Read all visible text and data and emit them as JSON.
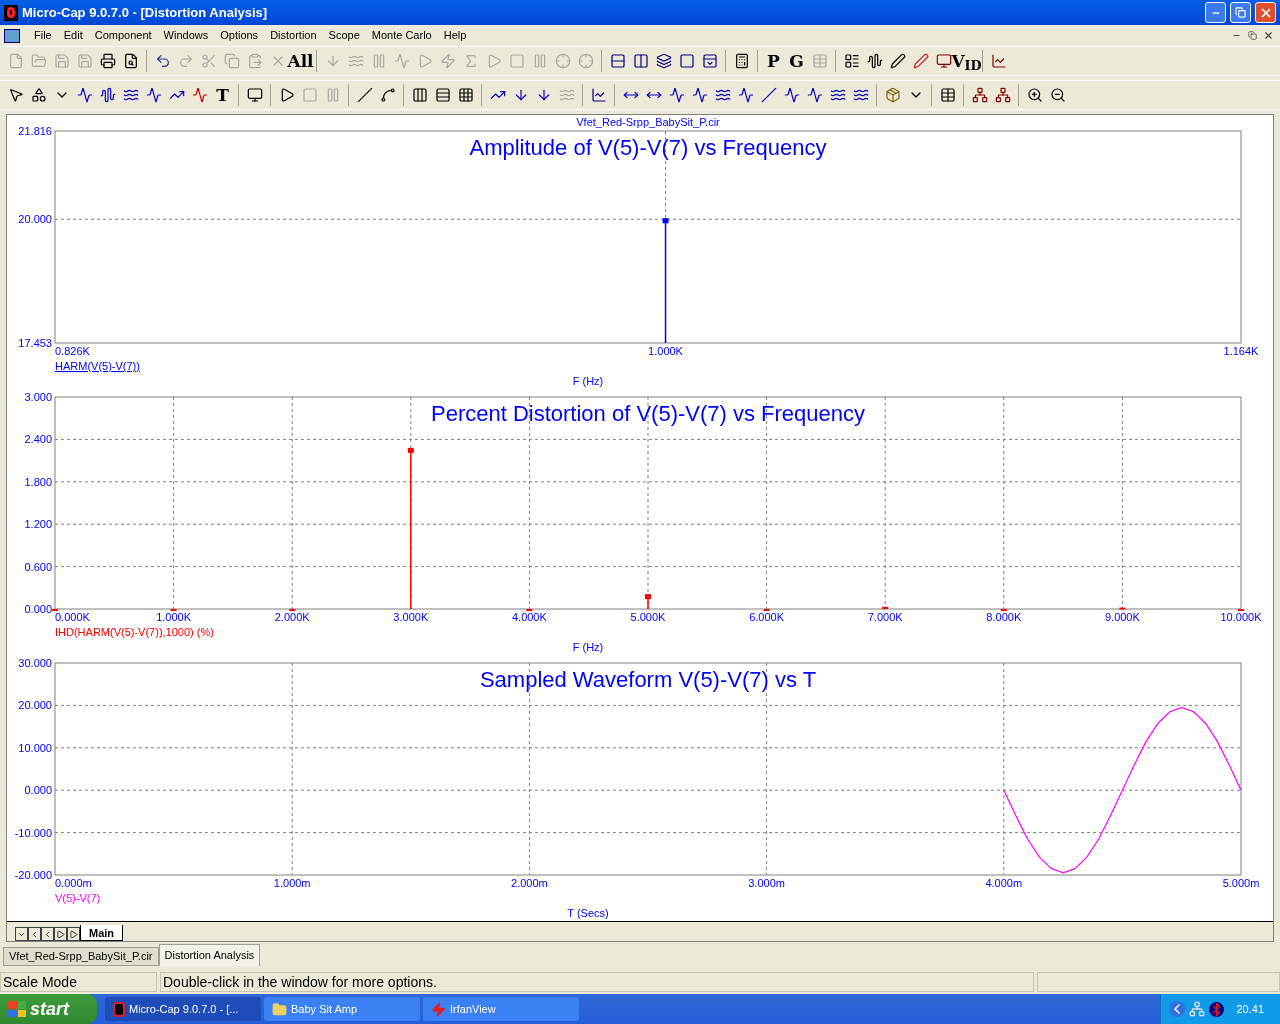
{
  "window": {
    "title": "Micro-Cap 9.0.7.0 - [Distortion Analysis]"
  },
  "menu": [
    "File",
    "Edit",
    "Component",
    "Windows",
    "Options",
    "Distortion",
    "Scope",
    "Monte Carlo",
    "Help"
  ],
  "toolbar_labels": [
    "All",
    "P",
    "G",
    "T",
    "V$_{I}$$_{D}$"
  ],
  "plots": [
    {
      "header": "Vfet_Red-Srpp_BabySit_P.cir",
      "chart_data": {
        "type": "bar",
        "title": "Amplitude of V(5)-V(7) vs Frequency",
        "xlabel": "F (Hz)",
        "x": [
          1.0
        ],
        "series": [
          {
            "name": "HARM(V(5)-V(7))",
            "color": "#0000ff",
            "values": [
              20.02
            ]
          }
        ],
        "grid": true,
        "xlim": [
          0.826,
          1.164
        ],
        "ylim": [
          17.453,
          21.816
        ],
        "xticks": [
          {
            "value": 0.826,
            "label": "0.826K"
          },
          {
            "value": 1.0,
            "label": "1.000K"
          },
          {
            "value": 1.164,
            "label": "1.164K"
          }
        ],
        "yticks": [
          {
            "value": 17.453,
            "label": "17.453"
          },
          {
            "value": 20,
            "label": "20.000"
          },
          {
            "value": 21.816,
            "label": "21.816"
          }
        ]
      }
    },
    {
      "chart_data": {
        "type": "bar",
        "title": "Percent Distortion of V(5)-V(7) vs Frequency",
        "xlabel": "F (Hz)",
        "x": [
          0,
          1,
          2,
          3,
          4,
          5,
          6,
          7,
          8,
          9,
          10
        ],
        "series": [
          {
            "name": "IHD(HARM(V(5)-V(7)),1000) (%)",
            "color": "#ff0000",
            "values": [
              0,
              0,
              0,
              2.28,
              0,
              0.21,
              0,
              0.03,
              0,
              0.02,
              0
            ]
          }
        ],
        "grid": true,
        "xlim": [
          0,
          10
        ],
        "ylim": [
          0,
          3
        ],
        "xticks": [
          {
            "value": 0,
            "label": "0.000K"
          },
          {
            "value": 1,
            "label": "1.000K"
          },
          {
            "value": 2,
            "label": "2.000K"
          },
          {
            "value": 3,
            "label": "3.000K"
          },
          {
            "value": 4,
            "label": "4.000K"
          },
          {
            "value": 5,
            "label": "5.000K"
          },
          {
            "value": 6,
            "label": "6.000K"
          },
          {
            "value": 7,
            "label": "7.000K"
          },
          {
            "value": 8,
            "label": "8.000K"
          },
          {
            "value": 9,
            "label": "9.000K"
          },
          {
            "value": 10,
            "label": "10.000K"
          }
        ],
        "yticks": [
          {
            "value": 0,
            "label": "0.000"
          },
          {
            "value": 0.6,
            "label": "0.600"
          },
          {
            "value": 1.2,
            "label": "1.200"
          },
          {
            "value": 1.8,
            "label": "1.800"
          },
          {
            "value": 2.4,
            "label": "2.400"
          },
          {
            "value": 3,
            "label": "3.000"
          }
        ]
      }
    },
    {
      "chart_data": {
        "type": "line",
        "title": "Sampled Waveform  V(5)-V(7) vs T",
        "xlabel": "T (Secs)",
        "x": [
          4.0,
          4.05,
          4.1,
          4.15,
          4.2,
          4.25,
          4.3,
          4.35,
          4.4,
          4.45,
          4.5,
          4.55,
          4.6,
          4.65,
          4.7,
          4.75,
          4.8,
          4.85,
          4.9,
          4.95,
          5.0
        ],
        "series": [
          {
            "name": "V(5)-V(7)",
            "color": "#ff00ff",
            "values": [
              0,
              -6.0,
              -11.5,
              -15.8,
              -18.5,
              -19.5,
              -18.5,
              -15.8,
              -11.5,
              -6.0,
              0,
              6.0,
              11.5,
              15.8,
              18.5,
              19.5,
              18.5,
              15.8,
              11.5,
              6.0,
              0
            ]
          }
        ],
        "grid": true,
        "xlim": [
          0,
          5
        ],
        "ylim": [
          -20,
          30
        ],
        "xticks": [
          {
            "value": 0,
            "label": "0.000m"
          },
          {
            "value": 1,
            "label": "1.000m"
          },
          {
            "value": 2,
            "label": "2.000m"
          },
          {
            "value": 3,
            "label": "3.000m"
          },
          {
            "value": 4,
            "label": "4.000m"
          },
          {
            "value": 5,
            "label": "5.000m"
          }
        ],
        "yticks": [
          {
            "value": -20,
            "label": "-20.000"
          },
          {
            "value": -10,
            "label": "-10.000"
          },
          {
            "value": 0,
            "label": "0.000"
          },
          {
            "value": 10,
            "label": "10.000"
          },
          {
            "value": 20,
            "label": "20.000"
          },
          {
            "value": 30,
            "label": "30.000"
          }
        ]
      }
    }
  ],
  "sheet_tabs": [
    {
      "label": "Main",
      "selected": true
    }
  ],
  "doc_tabs": [
    {
      "label": "Vfet_Red-Srpp_BabySit_P.cir",
      "selected": false
    },
    {
      "label": "Distortion Analysis",
      "selected": true
    }
  ],
  "status_bar": [
    "Scale Mode",
    "Double-click in the window for more options."
  ],
  "taskbar": {
    "start": "start",
    "tasks": [
      {
        "label": "Micro-Cap 9.0.7.0 - [...",
        "selected": true
      },
      {
        "label": "Baby Sit Amp",
        "selected": false
      },
      {
        "label": "IrfanView",
        "selected": false
      }
    ],
    "clock": "20.41"
  }
}
